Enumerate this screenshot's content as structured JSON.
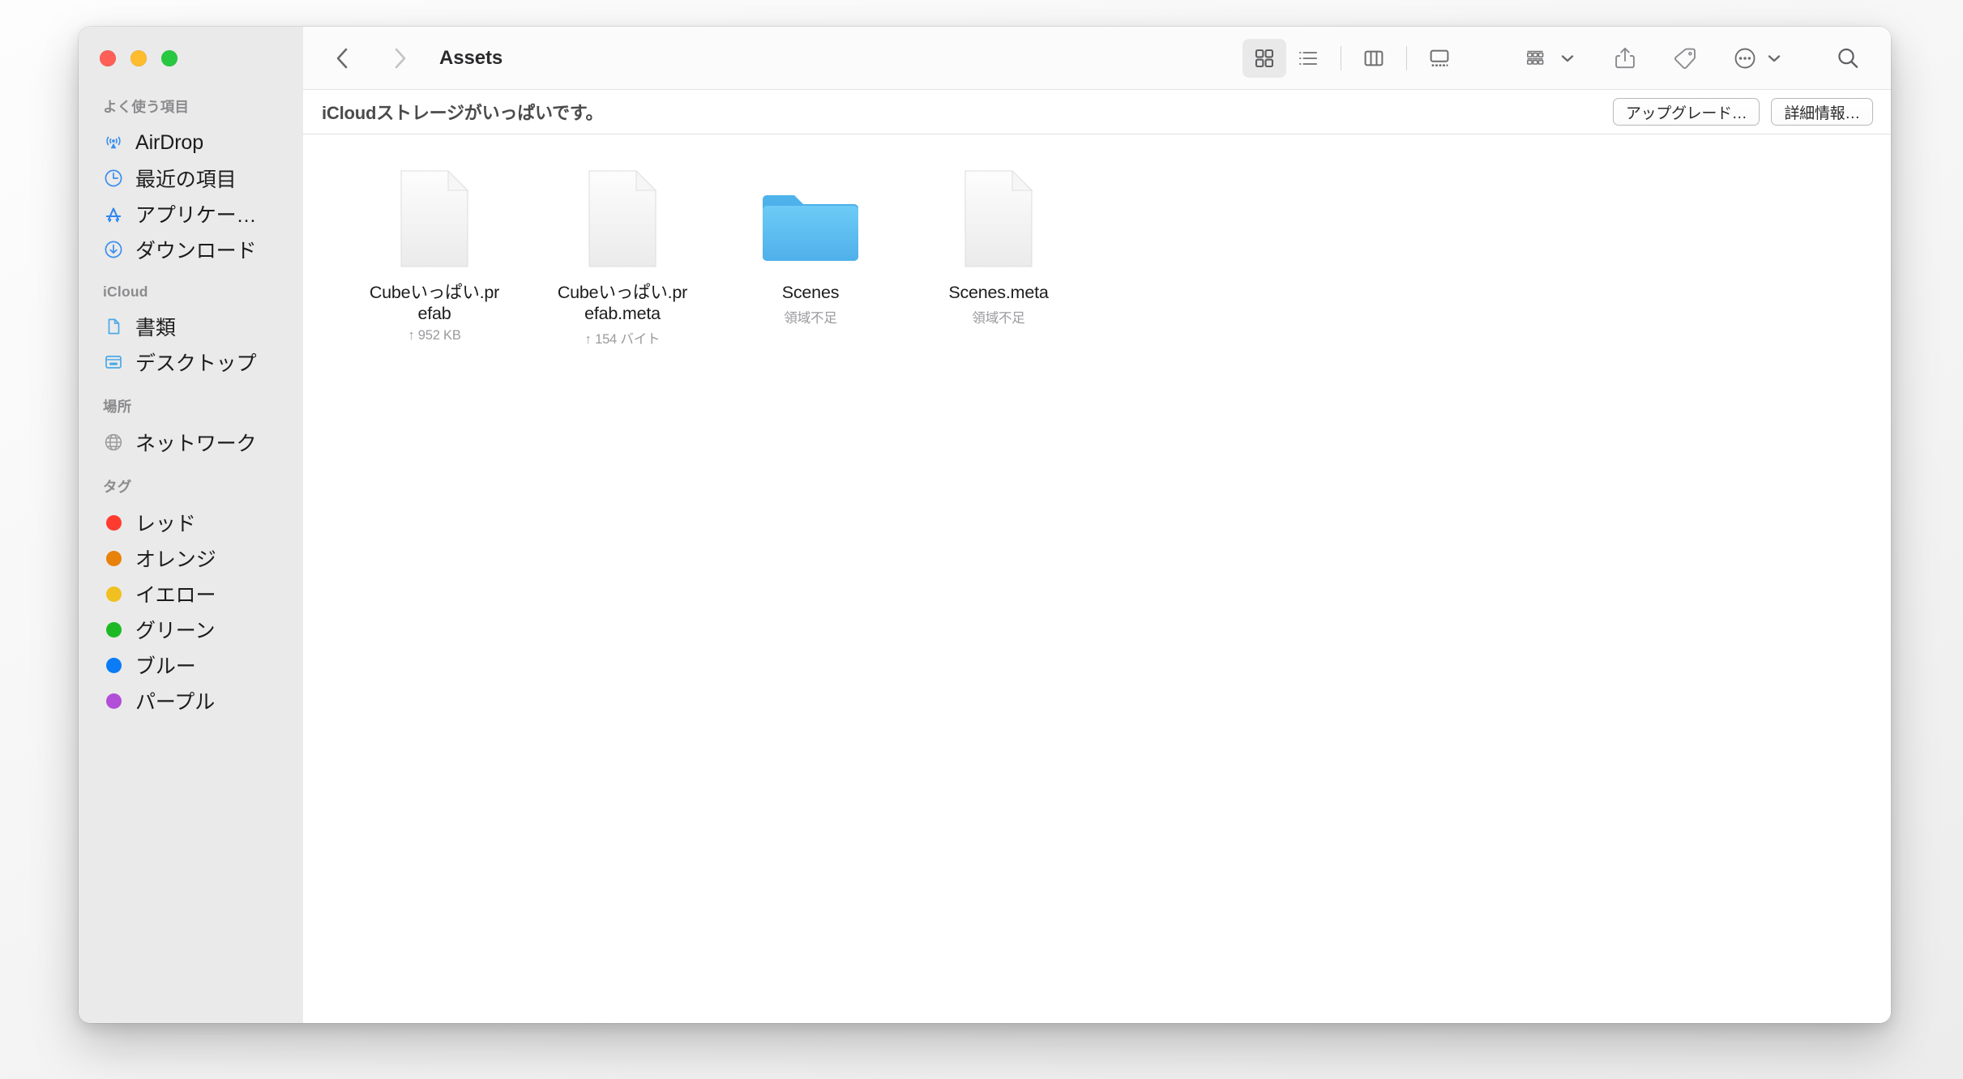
{
  "window": {
    "traffic_lights": [
      {
        "name": "close",
        "color": "#ff5f57"
      },
      {
        "name": "minimize",
        "color": "#febc2e"
      },
      {
        "name": "maximize",
        "color": "#28c840"
      }
    ]
  },
  "toolbar": {
    "back_label": "‹",
    "forward_label": "›",
    "breadcrumb": "Assets",
    "view_modes": [
      {
        "id": "icon",
        "name": "icon-view",
        "active": true
      },
      {
        "id": "list",
        "name": "list-view",
        "active": false
      },
      {
        "id": "column",
        "name": "column-view",
        "active": false
      },
      {
        "id": "gallery",
        "name": "gallery-view",
        "active": false
      }
    ],
    "group_by": "group-by-button",
    "share": "share-button",
    "tags": "tags-button",
    "more": "more-actions-button",
    "search": "search-button"
  },
  "banner": {
    "message": "iCloudストレージがいっぱいです。",
    "upgrade_label": "アップグレード…",
    "details_label": "詳細情報…"
  },
  "sidebar": {
    "sections": [
      {
        "title": "よく使う項目",
        "items": [
          {
            "label": "AirDrop",
            "icon": "airdrop-icon"
          },
          {
            "label": "最近の項目",
            "icon": "clock-icon"
          },
          {
            "label": "アプリケー…",
            "icon": "applications-icon"
          },
          {
            "label": "ダウンロード",
            "icon": "downloads-icon"
          }
        ]
      },
      {
        "title": "iCloud",
        "items": [
          {
            "label": "書類",
            "icon": "documents-icon"
          },
          {
            "label": "デスクトップ",
            "icon": "desktop-icon"
          }
        ]
      },
      {
        "title": "場所",
        "items": [
          {
            "label": "ネットワーク",
            "icon": "network-icon"
          }
        ]
      },
      {
        "title": "タグ",
        "items": [
          {
            "label": "レッド",
            "icon": "tag-dot-icon",
            "color": "#ff3b30"
          },
          {
            "label": "オレンジ",
            "icon": "tag-dot-icon",
            "color": "#e8820c"
          },
          {
            "label": "イエロー",
            "icon": "tag-dot-icon",
            "color": "#f0c020"
          },
          {
            "label": "グリーン",
            "icon": "tag-dot-icon",
            "color": "#1db924"
          },
          {
            "label": "ブルー",
            "icon": "tag-dot-icon",
            "color": "#0a7cf5"
          },
          {
            "label": "パープル",
            "icon": "tag-dot-icon",
            "color": "#b14fd8"
          }
        ]
      }
    ]
  },
  "files": [
    {
      "name": "Cubeいっぱい.prefab",
      "sub": "↑ 952 KB",
      "kind": "document"
    },
    {
      "name": "Cubeいっぱい.prefab.meta",
      "sub": "↑ 154 バイト",
      "kind": "document"
    },
    {
      "name": "Scenes",
      "sub": "領域不足",
      "kind": "folder"
    },
    {
      "name": "Scenes.meta",
      "sub": "領域不足",
      "kind": "document"
    }
  ]
}
